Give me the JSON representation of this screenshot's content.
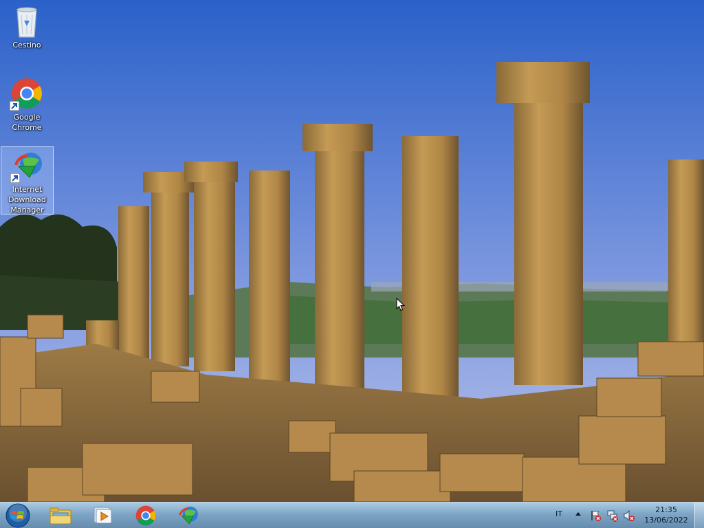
{
  "desktop": {
    "icons": [
      {
        "label": "Cestino",
        "icon": "recycle-bin-icon"
      },
      {
        "label": "Google Chrome",
        "icon": "chrome-icon",
        "shortcut": true
      },
      {
        "label": "Internet Download Manager",
        "icon": "idm-icon",
        "shortcut": true,
        "selected": true
      }
    ]
  },
  "taskbar": {
    "pinned": [
      {
        "icon": "windows-explorer-icon"
      },
      {
        "icon": "media-player-icon"
      },
      {
        "icon": "chrome-icon"
      },
      {
        "icon": "idm-icon"
      }
    ],
    "tray": {
      "language": "IT",
      "icons": [
        "flag-error-icon",
        "network-error-icon",
        "speaker-muted-icon"
      ]
    },
    "clock": {
      "time": "21:35",
      "date": "13/06/2022"
    }
  },
  "colors": {
    "sky_top": "#2a61c9",
    "sky_bottom": "#a5b7e8",
    "stone": "#b68a45",
    "taskbar": "#7fa3c4"
  }
}
